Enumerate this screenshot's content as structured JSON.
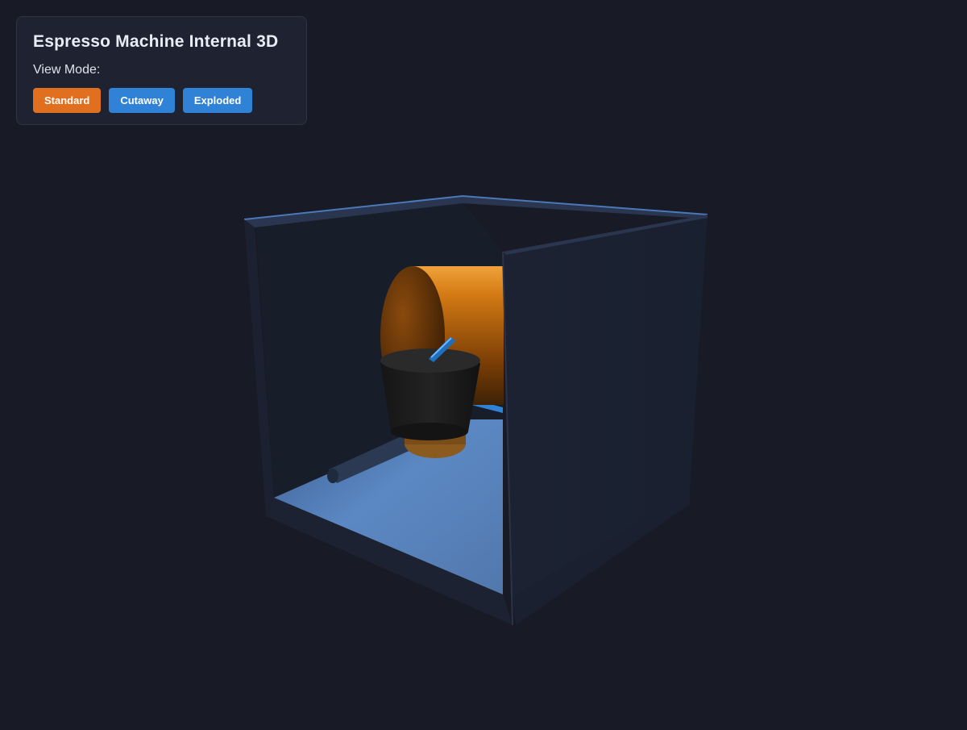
{
  "panel": {
    "title": "Espresso Machine Internal 3D",
    "view_mode_label": "View Mode:",
    "buttons": [
      {
        "label": "Standard",
        "active": true
      },
      {
        "label": "Cutaway",
        "active": false
      },
      {
        "label": "Exploded",
        "active": false
      }
    ]
  },
  "scene": {
    "background": "#181a25",
    "housing_color": "#1b2130",
    "housing_edge": "#4a78b8",
    "floor_light": "#5f8cc8",
    "boiler_color": "#d9851a",
    "group_head_color": "#202020",
    "accent_blue": "#2f82d6",
    "active_button_color": "#e07020"
  }
}
